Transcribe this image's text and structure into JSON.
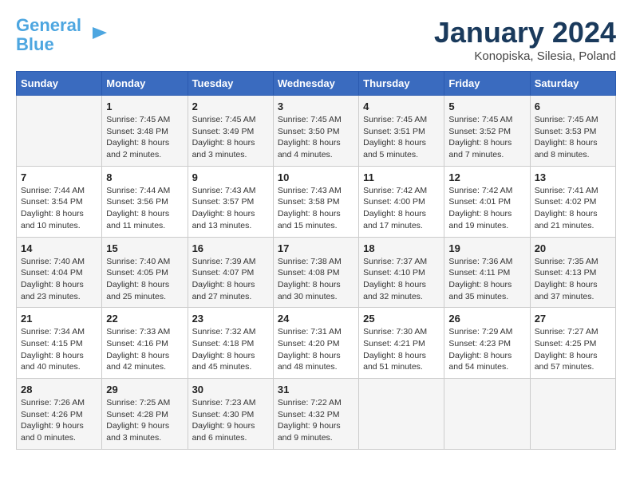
{
  "logo": {
    "line1": "General",
    "line2": "Blue"
  },
  "title": "January 2024",
  "location": "Konopiska, Silesia, Poland",
  "days_of_week": [
    "Sunday",
    "Monday",
    "Tuesday",
    "Wednesday",
    "Thursday",
    "Friday",
    "Saturday"
  ],
  "weeks": [
    [
      {
        "day": "",
        "info": ""
      },
      {
        "day": "1",
        "info": "Sunrise: 7:45 AM\nSunset: 3:48 PM\nDaylight: 8 hours\nand 2 minutes."
      },
      {
        "day": "2",
        "info": "Sunrise: 7:45 AM\nSunset: 3:49 PM\nDaylight: 8 hours\nand 3 minutes."
      },
      {
        "day": "3",
        "info": "Sunrise: 7:45 AM\nSunset: 3:50 PM\nDaylight: 8 hours\nand 4 minutes."
      },
      {
        "day": "4",
        "info": "Sunrise: 7:45 AM\nSunset: 3:51 PM\nDaylight: 8 hours\nand 5 minutes."
      },
      {
        "day": "5",
        "info": "Sunrise: 7:45 AM\nSunset: 3:52 PM\nDaylight: 8 hours\nand 7 minutes."
      },
      {
        "day": "6",
        "info": "Sunrise: 7:45 AM\nSunset: 3:53 PM\nDaylight: 8 hours\nand 8 minutes."
      }
    ],
    [
      {
        "day": "7",
        "info": "Sunrise: 7:44 AM\nSunset: 3:54 PM\nDaylight: 8 hours\nand 10 minutes."
      },
      {
        "day": "8",
        "info": "Sunrise: 7:44 AM\nSunset: 3:56 PM\nDaylight: 8 hours\nand 11 minutes."
      },
      {
        "day": "9",
        "info": "Sunrise: 7:43 AM\nSunset: 3:57 PM\nDaylight: 8 hours\nand 13 minutes."
      },
      {
        "day": "10",
        "info": "Sunrise: 7:43 AM\nSunset: 3:58 PM\nDaylight: 8 hours\nand 15 minutes."
      },
      {
        "day": "11",
        "info": "Sunrise: 7:42 AM\nSunset: 4:00 PM\nDaylight: 8 hours\nand 17 minutes."
      },
      {
        "day": "12",
        "info": "Sunrise: 7:42 AM\nSunset: 4:01 PM\nDaylight: 8 hours\nand 19 minutes."
      },
      {
        "day": "13",
        "info": "Sunrise: 7:41 AM\nSunset: 4:02 PM\nDaylight: 8 hours\nand 21 minutes."
      }
    ],
    [
      {
        "day": "14",
        "info": "Sunrise: 7:40 AM\nSunset: 4:04 PM\nDaylight: 8 hours\nand 23 minutes."
      },
      {
        "day": "15",
        "info": "Sunrise: 7:40 AM\nSunset: 4:05 PM\nDaylight: 8 hours\nand 25 minutes."
      },
      {
        "day": "16",
        "info": "Sunrise: 7:39 AM\nSunset: 4:07 PM\nDaylight: 8 hours\nand 27 minutes."
      },
      {
        "day": "17",
        "info": "Sunrise: 7:38 AM\nSunset: 4:08 PM\nDaylight: 8 hours\nand 30 minutes."
      },
      {
        "day": "18",
        "info": "Sunrise: 7:37 AM\nSunset: 4:10 PM\nDaylight: 8 hours\nand 32 minutes."
      },
      {
        "day": "19",
        "info": "Sunrise: 7:36 AM\nSunset: 4:11 PM\nDaylight: 8 hours\nand 35 minutes."
      },
      {
        "day": "20",
        "info": "Sunrise: 7:35 AM\nSunset: 4:13 PM\nDaylight: 8 hours\nand 37 minutes."
      }
    ],
    [
      {
        "day": "21",
        "info": "Sunrise: 7:34 AM\nSunset: 4:15 PM\nDaylight: 8 hours\nand 40 minutes."
      },
      {
        "day": "22",
        "info": "Sunrise: 7:33 AM\nSunset: 4:16 PM\nDaylight: 8 hours\nand 42 minutes."
      },
      {
        "day": "23",
        "info": "Sunrise: 7:32 AM\nSunset: 4:18 PM\nDaylight: 8 hours\nand 45 minutes."
      },
      {
        "day": "24",
        "info": "Sunrise: 7:31 AM\nSunset: 4:20 PM\nDaylight: 8 hours\nand 48 minutes."
      },
      {
        "day": "25",
        "info": "Sunrise: 7:30 AM\nSunset: 4:21 PM\nDaylight: 8 hours\nand 51 minutes."
      },
      {
        "day": "26",
        "info": "Sunrise: 7:29 AM\nSunset: 4:23 PM\nDaylight: 8 hours\nand 54 minutes."
      },
      {
        "day": "27",
        "info": "Sunrise: 7:27 AM\nSunset: 4:25 PM\nDaylight: 8 hours\nand 57 minutes."
      }
    ],
    [
      {
        "day": "28",
        "info": "Sunrise: 7:26 AM\nSunset: 4:26 PM\nDaylight: 9 hours\nand 0 minutes."
      },
      {
        "day": "29",
        "info": "Sunrise: 7:25 AM\nSunset: 4:28 PM\nDaylight: 9 hours\nand 3 minutes."
      },
      {
        "day": "30",
        "info": "Sunrise: 7:23 AM\nSunset: 4:30 PM\nDaylight: 9 hours\nand 6 minutes."
      },
      {
        "day": "31",
        "info": "Sunrise: 7:22 AM\nSunset: 4:32 PM\nDaylight: 9 hours\nand 9 minutes."
      },
      {
        "day": "",
        "info": ""
      },
      {
        "day": "",
        "info": ""
      },
      {
        "day": "",
        "info": ""
      }
    ]
  ]
}
